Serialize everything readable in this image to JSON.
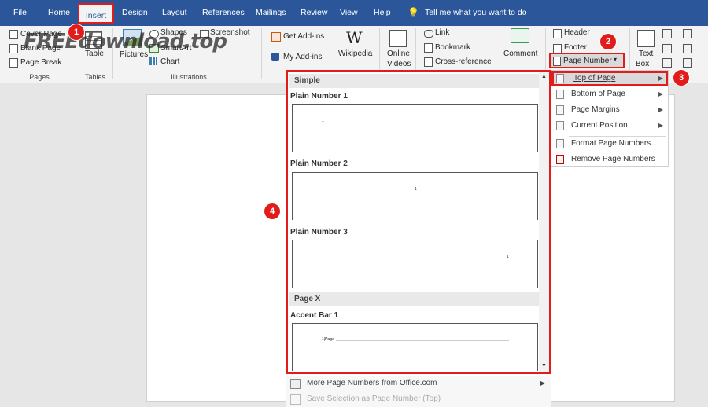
{
  "menubar": {
    "tabs": [
      {
        "label": "File"
      },
      {
        "label": "Home"
      },
      {
        "label": "Insert"
      },
      {
        "label": "Design"
      },
      {
        "label": "Layout"
      },
      {
        "label": "References"
      },
      {
        "label": "Mailings"
      },
      {
        "label": "Review"
      },
      {
        "label": "View"
      },
      {
        "label": "Help"
      }
    ],
    "tell_me": "Tell me what you want to do"
  },
  "ribbon": {
    "pages": {
      "cover_page": "Cover Page",
      "blank_page": "Blank Page",
      "page_break": "Page Break",
      "group": "Pages"
    },
    "tables": {
      "table": "Table",
      "group": "Tables"
    },
    "illustrations": {
      "pictures": "Pictures",
      "shapes": "Shapes",
      "smartart": "SmartArt",
      "chart": "Chart",
      "screenshot": "Screenshot",
      "group": "Illustrations"
    },
    "addins": {
      "get_addins": "Get Add-ins",
      "my_addins": "My Add-ins",
      "wikipedia": "Wikipedia"
    },
    "media": {
      "online_videos_1": "Online",
      "online_videos_2": "Videos"
    },
    "links": {
      "link": "Link",
      "bookmark": "Bookmark",
      "cross_reference": "Cross-reference"
    },
    "comments": {
      "comment": "Comment"
    },
    "header_footer": {
      "header": "Header",
      "footer": "Footer",
      "page_number": "Page Number"
    },
    "text": {
      "text_box_1": "Text",
      "text_box_2": "Box"
    }
  },
  "watermark": "FREEdownload.top",
  "gallery": {
    "section1": "Simple",
    "items": [
      {
        "label": "Plain Number 1",
        "num": "1"
      },
      {
        "label": "Plain Number 2",
        "num": "1"
      },
      {
        "label": "Plain Number 3",
        "num": "1"
      }
    ],
    "section2": "Page X",
    "accent": {
      "label": "Accent Bar 1",
      "num": "1|Page"
    }
  },
  "submenu": {
    "items": [
      {
        "label": "Top of Page",
        "has_arrow": true
      },
      {
        "label": "Bottom of Page",
        "has_arrow": true
      },
      {
        "label": "Page Margins",
        "has_arrow": true
      },
      {
        "label": "Current Position",
        "has_arrow": true
      },
      {
        "label": "Format Page Numbers...",
        "has_arrow": false
      },
      {
        "label": "Remove Page Numbers",
        "has_arrow": false
      }
    ]
  },
  "below": {
    "more": "More Page Numbers from Office.com",
    "save": "Save Selection as Page Number (Top)"
  },
  "callouts": [
    "1",
    "2",
    "3",
    "4"
  ],
  "colors": {
    "brand": "#2b579a",
    "highlight": "#e21b1b"
  }
}
